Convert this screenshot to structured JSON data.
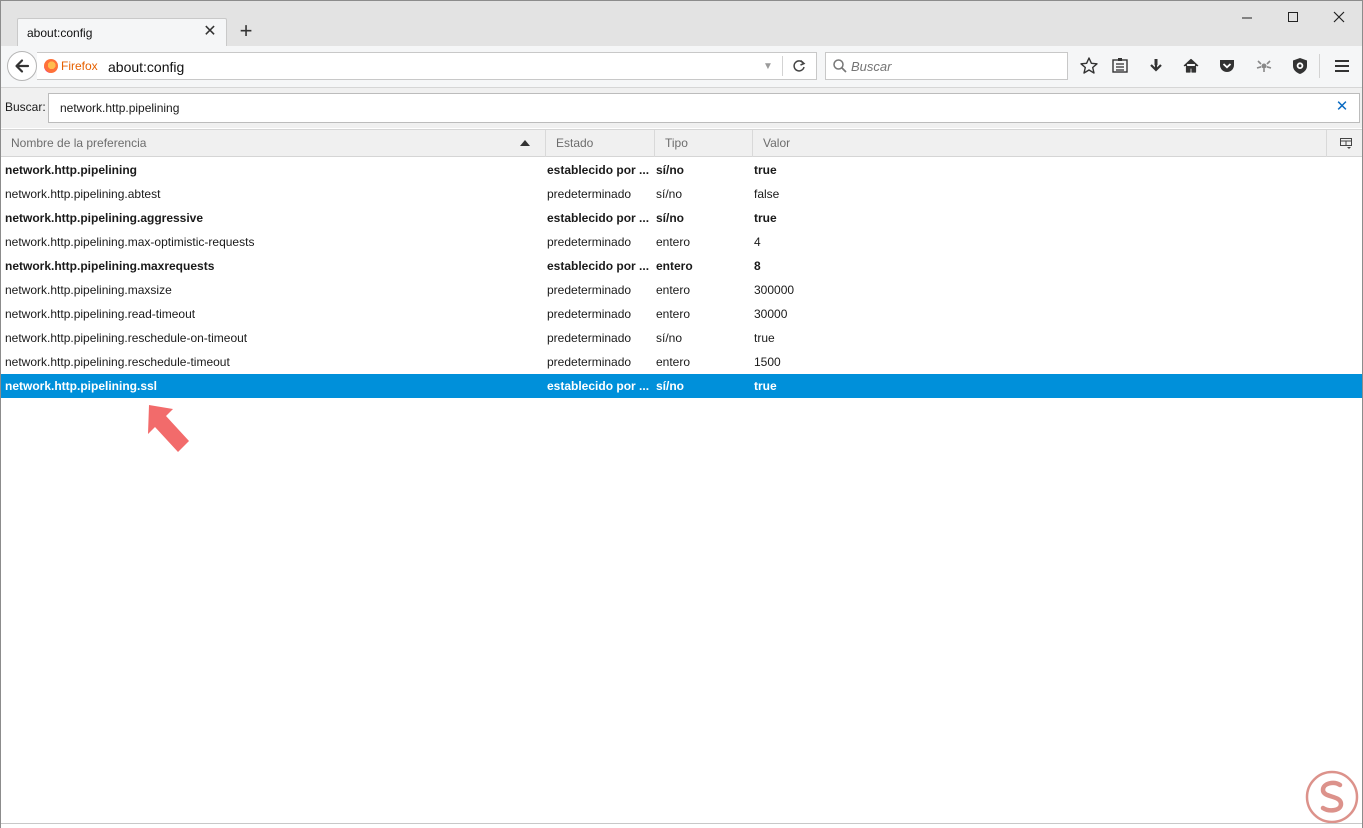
{
  "tab": {
    "title": "about:config"
  },
  "navbar": {
    "identity_label": "Firefox",
    "url": "about:config",
    "search_placeholder": "Buscar"
  },
  "config_search": {
    "label": "Buscar:",
    "value": "network.http.pipelining"
  },
  "columns": {
    "name": "Nombre de la preferencia",
    "status": "Estado",
    "type": "Tipo",
    "value": "Valor"
  },
  "rows": [
    {
      "name": "network.http.pipelining",
      "status": "establecido por ...",
      "type": "sí/no",
      "value": "true",
      "modified": true
    },
    {
      "name": "network.http.pipelining.abtest",
      "status": "predeterminado",
      "type": "sí/no",
      "value": "false",
      "modified": false
    },
    {
      "name": "network.http.pipelining.aggressive",
      "status": "establecido por ...",
      "type": "sí/no",
      "value": "true",
      "modified": true
    },
    {
      "name": "network.http.pipelining.max-optimistic-requests",
      "status": "predeterminado",
      "type": "entero",
      "value": "4",
      "modified": false
    },
    {
      "name": "network.http.pipelining.maxrequests",
      "status": "establecido por ...",
      "type": "entero",
      "value": "8",
      "modified": true
    },
    {
      "name": "network.http.pipelining.maxsize",
      "status": "predeterminado",
      "type": "entero",
      "value": "300000",
      "modified": false
    },
    {
      "name": "network.http.pipelining.read-timeout",
      "status": "predeterminado",
      "type": "entero",
      "value": "30000",
      "modified": false
    },
    {
      "name": "network.http.pipelining.reschedule-on-timeout",
      "status": "predeterminado",
      "type": "sí/no",
      "value": "true",
      "modified": false
    },
    {
      "name": "network.http.pipelining.reschedule-timeout",
      "status": "predeterminado",
      "type": "entero",
      "value": "1500",
      "modified": false
    },
    {
      "name": "network.http.pipelining.ssl",
      "status": "establecido por ...",
      "type": "sí/no",
      "value": "true",
      "modified": true,
      "selected": true
    }
  ],
  "colors": {
    "selection": "#0090da",
    "identity": "#e66000",
    "annotation_arrow": "#f26b6b",
    "watermark": "#c0392b"
  }
}
